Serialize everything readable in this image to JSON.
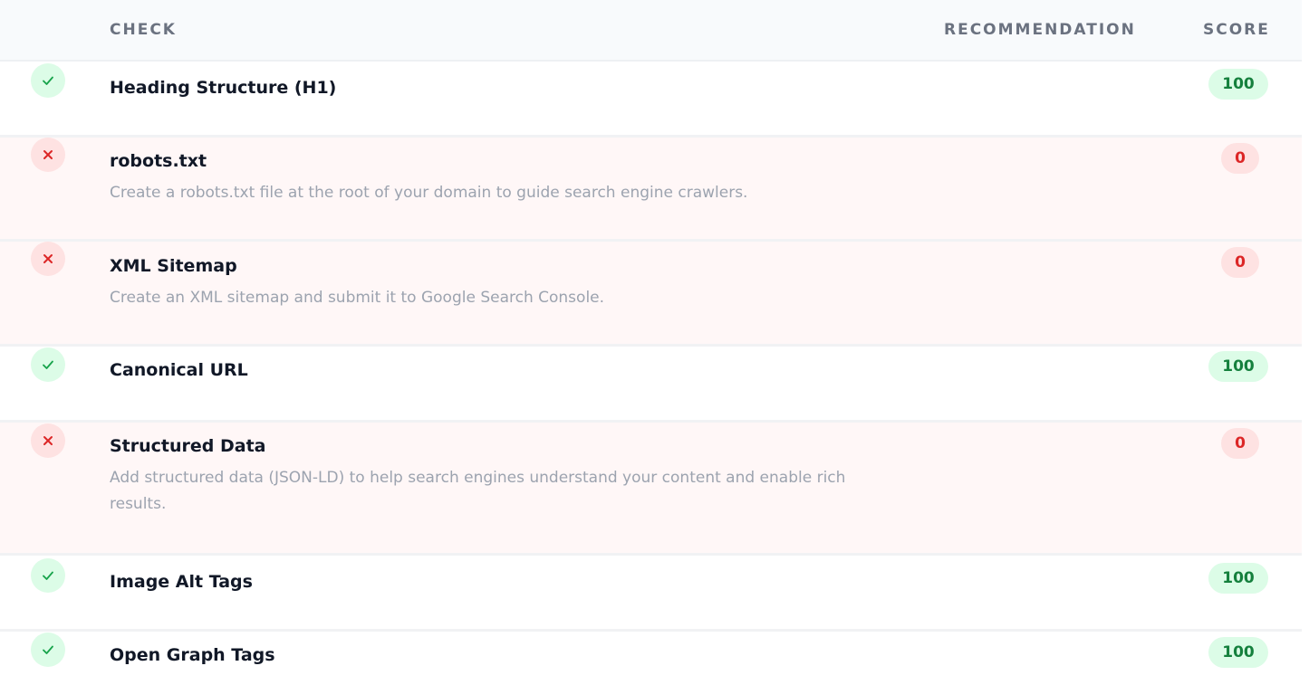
{
  "columns": {
    "check": "CHECK",
    "recommendation": "RECOMMENDATION",
    "score": "SCORE"
  },
  "colors": {
    "pass": "#15803d",
    "pass_bg": "#dcfce7",
    "fail": "#dc2626",
    "fail_bg": "#fee2e2",
    "fail_row_bg": "#fff7f7"
  },
  "rows": [
    {
      "status": "pass",
      "icon": "check-icon",
      "title": "Heading Structure (H1)",
      "recommendation": "",
      "score": "100"
    },
    {
      "status": "fail",
      "icon": "x-icon",
      "title": "robots.txt",
      "recommendation": "Create a robots.txt file at the root of your domain to guide search engine crawlers.",
      "score": "0"
    },
    {
      "status": "fail",
      "icon": "x-icon",
      "title": "XML Sitemap",
      "recommendation": "Create an XML sitemap and submit it to Google Search Console.",
      "score": "0"
    },
    {
      "status": "pass",
      "icon": "check-icon",
      "title": "Canonical URL",
      "recommendation": "",
      "score": "100"
    },
    {
      "status": "fail",
      "icon": "x-icon",
      "title": "Structured Data",
      "recommendation": "Add structured data (JSON-LD) to help search engines understand your content and enable rich results.",
      "score": "0"
    },
    {
      "status": "pass",
      "icon": "check-icon",
      "title": "Image Alt Tags",
      "recommendation": "",
      "score": "100"
    },
    {
      "status": "pass",
      "icon": "check-icon",
      "title": "Open Graph Tags",
      "recommendation": "",
      "score": "100"
    }
  ]
}
